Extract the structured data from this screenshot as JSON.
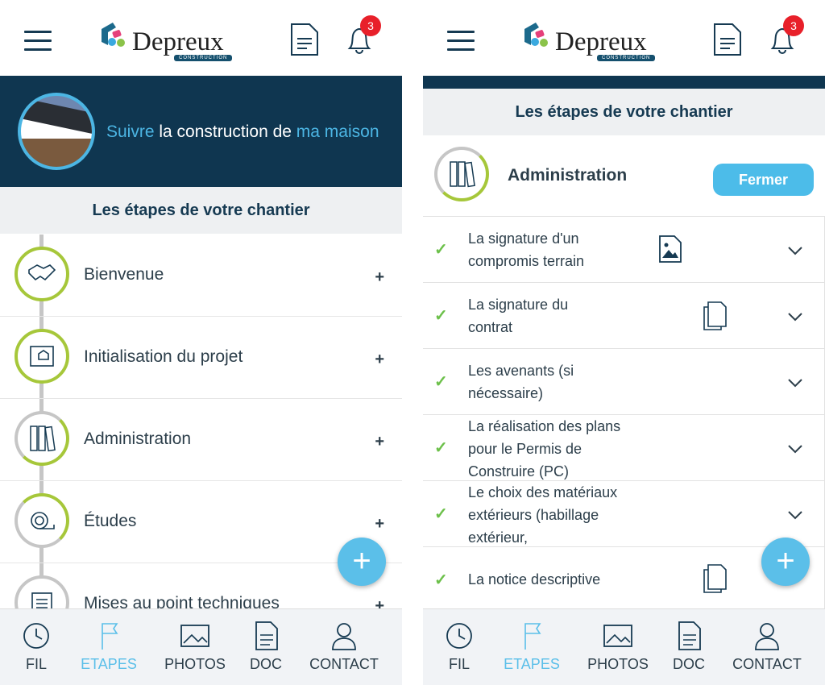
{
  "header": {
    "logo_text": "Depreux",
    "logo_sub": "CONSTRUCTION",
    "notifications": "3"
  },
  "banner": {
    "w1": "Suivre",
    "w2": " la construction de ",
    "w3": "ma maison"
  },
  "section_title": "Les étapes de votre chantier",
  "steps": [
    {
      "label": "Bienvenue",
      "icon": "handshake-icon",
      "status": "done"
    },
    {
      "label": "Initialisation du projet",
      "icon": "blueprint-icon",
      "status": "done"
    },
    {
      "label": "Administration",
      "icon": "binders-icon",
      "status": "partial"
    },
    {
      "label": "Études",
      "icon": "tape-measure-icon",
      "status": "partial"
    },
    {
      "label": "Mises au point techniques",
      "icon": "document-icon",
      "status": "pending"
    }
  ],
  "detail": {
    "title": "Administration",
    "close_label": "Fermer",
    "items": [
      {
        "text": "La signature d'un compromis terrain",
        "attachment": "image-file-icon"
      },
      {
        "text": "La signature du contrat",
        "attachment": "copy-icon"
      },
      {
        "text": "Les avenants (si nécessaire)",
        "attachment": ""
      },
      {
        "text": "La réalisation des plans pour le Permis de Construire (PC)",
        "attachment": ""
      },
      {
        "text": "Le choix des matériaux extérieurs (habillage extérieur,",
        "attachment": ""
      },
      {
        "text": "La notice descriptive",
        "attachment": "copy-icon"
      }
    ]
  },
  "fab_label": "+",
  "plus": "+",
  "check": "✓",
  "nav": [
    {
      "label": "FIL"
    },
    {
      "label": "ETAPES",
      "active": true
    },
    {
      "label": "PHOTOS"
    },
    {
      "label": "DOC"
    },
    {
      "label": "CONTACT"
    }
  ],
  "colors": {
    "dark": "#0f3650",
    "accent": "#4cbce9",
    "green": "#a6c73a",
    "badge": "#e8202a"
  }
}
